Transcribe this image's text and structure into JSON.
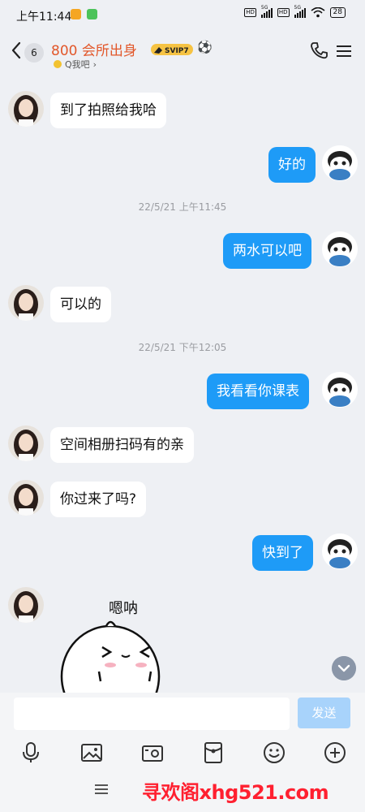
{
  "status_bar": {
    "time": "上午11:44",
    "net1": "HD",
    "gen1": "5G",
    "net2": "HD",
    "gen2": "5G",
    "battery": "28"
  },
  "header": {
    "unread_count": "6",
    "title": "800 会所出身",
    "badge": "SVIP7",
    "subtitle": "Q我吧"
  },
  "messages": [
    {
      "side": "left",
      "text": "到了拍照给我哈"
    },
    {
      "side": "right",
      "text": "好的"
    },
    {
      "timestamp": "22/5/21 上午11:45"
    },
    {
      "side": "right",
      "text": "两水可以吧"
    },
    {
      "side": "left",
      "text": "可以的"
    },
    {
      "timestamp": "22/5/21 下午12:05"
    },
    {
      "side": "right",
      "text": "我看看你课表"
    },
    {
      "side": "left",
      "text": "空间相册扫码有的亲"
    },
    {
      "side": "left",
      "text": "你过来了吗?"
    },
    {
      "side": "right",
      "text": "快到了"
    },
    {
      "side": "left",
      "sticker": "嗯呐"
    }
  ],
  "input": {
    "value": "",
    "send_label": "发送"
  },
  "toolbar": [
    "microphone-icon",
    "image-icon",
    "camera-icon",
    "red-packet-icon",
    "emoji-icon",
    "plus-icon"
  ],
  "watermark": "寻欢阁xhg521.com",
  "colors": {
    "accent": "#1e9bf7",
    "title": "#e2572a",
    "send_disabled": "#a8d3fb",
    "watermark": "#ff2030"
  }
}
